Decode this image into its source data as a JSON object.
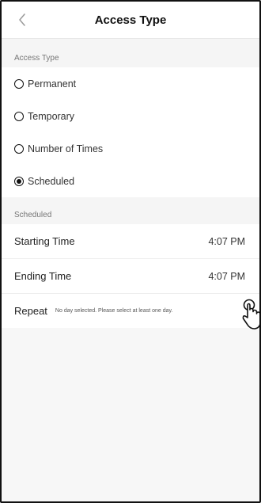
{
  "header": {
    "title": "Access Type",
    "back_icon": "chevron-left-icon"
  },
  "access_type_section": {
    "label": "Access Type",
    "options": [
      {
        "label": "Permanent",
        "selected": false
      },
      {
        "label": "Temporary",
        "selected": false
      },
      {
        "label": "Number of Times",
        "selected": false
      },
      {
        "label": "Scheduled",
        "selected": true
      }
    ]
  },
  "scheduled_section": {
    "label": "Scheduled",
    "starting_time": {
      "label": "Starting Time",
      "value": "4:07 PM"
    },
    "ending_time": {
      "label": "Ending Time",
      "value": "4:07 PM"
    },
    "repeat": {
      "label": "Repeat",
      "hint": "No day selected. Please select at least one day."
    }
  },
  "overlay": {
    "pointer_icon": "hand-pointer-icon"
  }
}
